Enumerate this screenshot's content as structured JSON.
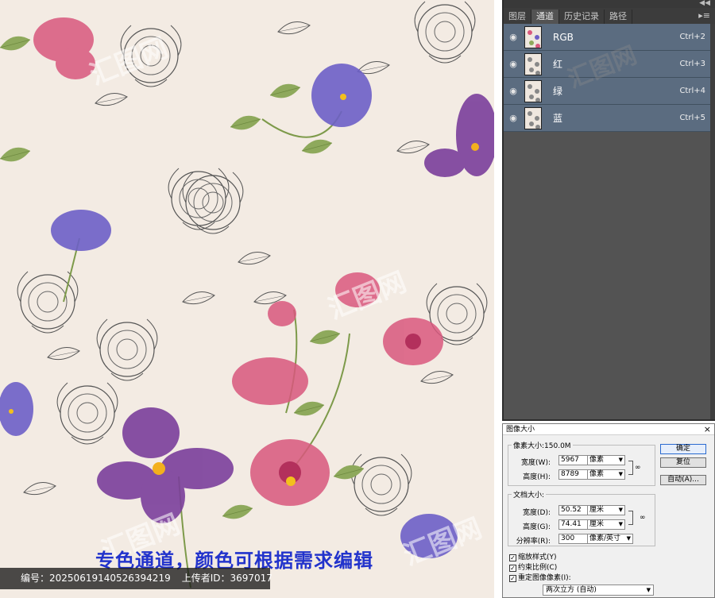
{
  "artwork": {
    "caption": "专色通道，颜色可根据需求编辑",
    "watermark_text": "汇图网",
    "info": {
      "id_label": "编号：",
      "id_value": "20250619140526394219",
      "uploader_label": "上传者ID：",
      "uploader_value": "3697017"
    }
  },
  "channels_panel": {
    "tabs": [
      "图层",
      "通道",
      "历史记录",
      "路径"
    ],
    "active_tab": "通道",
    "channels": [
      {
        "name": "RGB",
        "shortcut": "Ctrl+2",
        "thumb": "color"
      },
      {
        "name": "红",
        "shortcut": "Ctrl+3",
        "thumb": "gray"
      },
      {
        "name": "绿",
        "shortcut": "Ctrl+4",
        "thumb": "gray"
      },
      {
        "name": "蓝",
        "shortcut": "Ctrl+5",
        "thumb": "gray"
      }
    ],
    "icons": {
      "visibility": "eye-icon",
      "collapse": "double-arrow-icon",
      "menu": "panel-menu-icon"
    }
  },
  "image_size_dialog": {
    "title": "图像大小",
    "pixel_dimensions_label": "像素大小:150.0M",
    "width_label": "宽度(W):",
    "width_value": "5967",
    "width_unit": "像素",
    "height_label": "高度(H):",
    "height_value": "8789",
    "height_unit": "像素",
    "document_size_label": "文档大小:",
    "doc_width_label": "宽度(D):",
    "doc_width_value": "50.52",
    "doc_width_unit": "厘米",
    "doc_height_label": "高度(G):",
    "doc_height_value": "74.41",
    "doc_height_unit": "厘米",
    "resolution_label": "分辨率(R):",
    "resolution_value": "300",
    "resolution_unit": "像素/英寸",
    "ok_label": "确定",
    "reset_label": "复位",
    "auto_label": "自动(A)...",
    "scale_styles_label": "缩放样式(Y)",
    "constrain_label": "约束比例(C)",
    "resample_label": "重定图像像素(I):",
    "resample_method": "两次立方 (自动)"
  }
}
